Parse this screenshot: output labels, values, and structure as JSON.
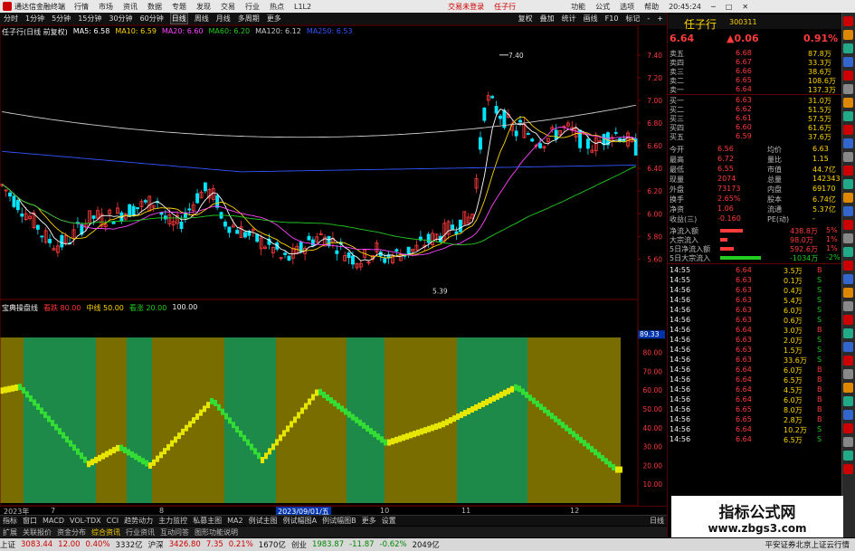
{
  "titlebar": {
    "app_name": "通达信金融终端",
    "menus": [
      "行情",
      "市场",
      "资讯",
      "数据",
      "专题",
      "发现",
      "交易",
      "行业",
      "热点",
      "L1L2"
    ],
    "center_links": [
      "交易未登录",
      "任子行"
    ],
    "right_menus": [
      "功能",
      "公式",
      "选项",
      "帮助"
    ],
    "time": "20:45:24"
  },
  "toolbar": {
    "periods": [
      "分时",
      "1分钟",
      "5分钟",
      "15分钟",
      "30分钟",
      "60分钟",
      "日线",
      "周线",
      "月线",
      "多周期",
      "更多"
    ],
    "active_period": "日线",
    "right_buttons": [
      "复权",
      "叠加",
      "统计",
      "画线",
      "F10",
      "标记",
      "-",
      "+"
    ]
  },
  "main_chart": {
    "stock_label": "任子行(日线 前复权)",
    "ma_labels": [
      {
        "text": "MA5: 6.58",
        "color": "#ffffff"
      },
      {
        "text": "MA10: 6.59",
        "color": "#ffd400"
      },
      {
        "text": "MA20: 6.60",
        "color": "#ff44ff"
      },
      {
        "text": "MA60: 6.20",
        "color": "#22cc22"
      },
      {
        "text": "MA120: 6.12",
        "color": "#cccccc"
      },
      {
        "text": "MA250: 6.53",
        "color": "#3355ff"
      }
    ],
    "price_axis": [
      "7.40",
      "7.20",
      "7.00",
      "6.80",
      "6.60",
      "6.40",
      "6.20",
      "6.00",
      "5.80",
      "5.60"
    ],
    "high_marker": "7.40",
    "low_marker": "5.39"
  },
  "indicator": {
    "name": "宝典操盘线",
    "legend": [
      {
        "text": "看跌 80.00",
        "color": "#ff3333"
      },
      {
        "text": "中线 50.00",
        "color": "#ffd400"
      },
      {
        "text": "看涨 20.00",
        "color": "#22cc22"
      },
      {
        "text": "100.00",
        "color": "#eeeeee"
      }
    ],
    "axis": [
      "80.00",
      "70.00",
      "60.00",
      "50.00",
      "40.00",
      "30.00",
      "20.00",
      "10.00"
    ],
    "current_tag": "89.33"
  },
  "date_axis": {
    "labels": [
      "2023年",
      "7",
      "8",
      "9",
      "10",
      "11",
      "12"
    ],
    "cursor_date": "2023/09/01/五"
  },
  "quote": {
    "name": "任子行",
    "code": "300311",
    "price": "6.64",
    "change": "▲0.06",
    "pct": "0.91%",
    "asks": [
      {
        "label": "卖五",
        "price": "6.68",
        "vol": "87.8万"
      },
      {
        "label": "卖四",
        "price": "6.67",
        "vol": "33.3万"
      },
      {
        "label": "卖三",
        "price": "6.66",
        "vol": "38.6万"
      },
      {
        "label": "卖二",
        "price": "6.65",
        "vol": "108.6万"
      },
      {
        "label": "卖一",
        "price": "6.64",
        "vol": "137.3万"
      }
    ],
    "bids": [
      {
        "label": "买一",
        "price": "6.63",
        "vol": "31.0万"
      },
      {
        "label": "买二",
        "price": "6.62",
        "vol": "51.5万"
      },
      {
        "label": "买三",
        "price": "6.61",
        "vol": "57.5万"
      },
      {
        "label": "买四",
        "price": "6.60",
        "vol": "61.6万"
      },
      {
        "label": "买五",
        "price": "6.59",
        "vol": "37.6万"
      }
    ],
    "stats": [
      {
        "l1": "今开",
        "v1": "6.56",
        "l2": "均价",
        "v2": "6.63"
      },
      {
        "l1": "最高",
        "v1": "6.72",
        "l2": "量比",
        "v2": "1.15"
      },
      {
        "l1": "最低",
        "v1": "6.55",
        "l2": "市值",
        "v2": "44.7亿"
      },
      {
        "l1": "现量",
        "v1": "2074",
        "l2": "总量",
        "v2": "142343"
      },
      {
        "l1": "外盘",
        "v1": "73173",
        "l2": "内盘",
        "v2": "69170"
      },
      {
        "l1": "换手",
        "v1": "2.65%",
        "l2": "股本",
        "v2": "6.74亿"
      },
      {
        "l1": "净资",
        "v1": "1.06",
        "l2": "流通",
        "v2": "5.37亿"
      },
      {
        "l1": "收益(三)",
        "v1": "-0.160",
        "l2": "PE(动)",
        "v2": "-"
      }
    ],
    "flows": [
      {
        "label": "净流入额",
        "value": "438.8万",
        "pct": "5%",
        "color": "red",
        "bar": 0.5
      },
      {
        "label": "大宗流入",
        "value": "98.0万",
        "pct": "1%",
        "color": "red",
        "bar": 0.15
      },
      {
        "label": "5日净流入额",
        "value": "592.6万",
        "pct": "1%",
        "color": "red",
        "bar": 0.3
      },
      {
        "label": "5日大宗流入",
        "value": "-1034万",
        "pct": "-2%",
        "color": "grn",
        "bar": 0.9
      }
    ],
    "ticks": [
      {
        "t": "14:55",
        "p": "6.64",
        "v": "3.5万",
        "s": "B"
      },
      {
        "t": "14:55",
        "p": "6.63",
        "v": "0.1万",
        "s": "S"
      },
      {
        "t": "14:56",
        "p": "6.63",
        "v": "0.4万",
        "s": "S"
      },
      {
        "t": "14:56",
        "p": "6.63",
        "v": "5.4万",
        "s": "S"
      },
      {
        "t": "14:56",
        "p": "6.63",
        "v": "6.0万",
        "s": "S"
      },
      {
        "t": "14:56",
        "p": "6.63",
        "v": "0.6万",
        "s": "S"
      },
      {
        "t": "14:56",
        "p": "6.64",
        "v": "3.0万",
        "s": "B"
      },
      {
        "t": "14:56",
        "p": "6.63",
        "v": "2.0万",
        "s": "S"
      },
      {
        "t": "14:56",
        "p": "6.63",
        "v": "1.5万",
        "s": "S"
      },
      {
        "t": "14:56",
        "p": "6.63",
        "v": "33.6万",
        "s": "S"
      },
      {
        "t": "14:56",
        "p": "6.64",
        "v": "6.0万",
        "s": "B"
      },
      {
        "t": "14:56",
        "p": "6.64",
        "v": "6.5万",
        "s": "B"
      },
      {
        "t": "14:56",
        "p": "6.64",
        "v": "4.5万",
        "s": "B"
      },
      {
        "t": "14:56",
        "p": "6.64",
        "v": "6.0万",
        "s": "B"
      },
      {
        "t": "14:56",
        "p": "6.65",
        "v": "8.0万",
        "s": "B"
      },
      {
        "t": "14:56",
        "p": "6.65",
        "v": "2.8万",
        "s": "B"
      },
      {
        "t": "14:56",
        "p": "6.64",
        "v": "10.2万",
        "s": "S"
      },
      {
        "t": "14:56",
        "p": "6.64",
        "v": "6.5万",
        "s": "S"
      }
    ]
  },
  "bottom_tabs": [
    "指标",
    "窗口",
    "MACD",
    "VOL-TDX",
    "CCI",
    "趋势动力",
    "主力监控",
    "私募主图",
    "MA2",
    "例试主图",
    "例试幅图A",
    "例试幅图B",
    "更多",
    "设置"
  ],
  "bottom_left": "扩展",
  "bottom_sub": [
    "关联报价",
    "资金分布",
    "综合资讯",
    "行业资讯",
    "互动问答",
    "图形功能说明"
  ],
  "bottom_right": "日线",
  "statusbar": [
    {
      "name": "上证",
      "v1": "3083.44",
      "v2": "12.00",
      "v3": "0.40%",
      "v4": "3332亿"
    },
    {
      "name": "沪深",
      "v1": "3426.80",
      "v2": "7.35",
      "v3": "0.21%",
      "v4": "1670亿"
    },
    {
      "name": "创业",
      "v1": "1983.87",
      "v2": "-11.87",
      "v3": "-0.62%",
      "v4": "2049亿"
    }
  ],
  "status_right": "平安证券北京上证云行情",
  "watermark": {
    "cn": "指标公式网",
    "url": "www.zbgs3.com"
  },
  "colors": {
    "up": "#ff3b3b",
    "down": "#00e5ff",
    "olive": "#7a6d00",
    "green_zone": "#1e8a4a"
  }
}
